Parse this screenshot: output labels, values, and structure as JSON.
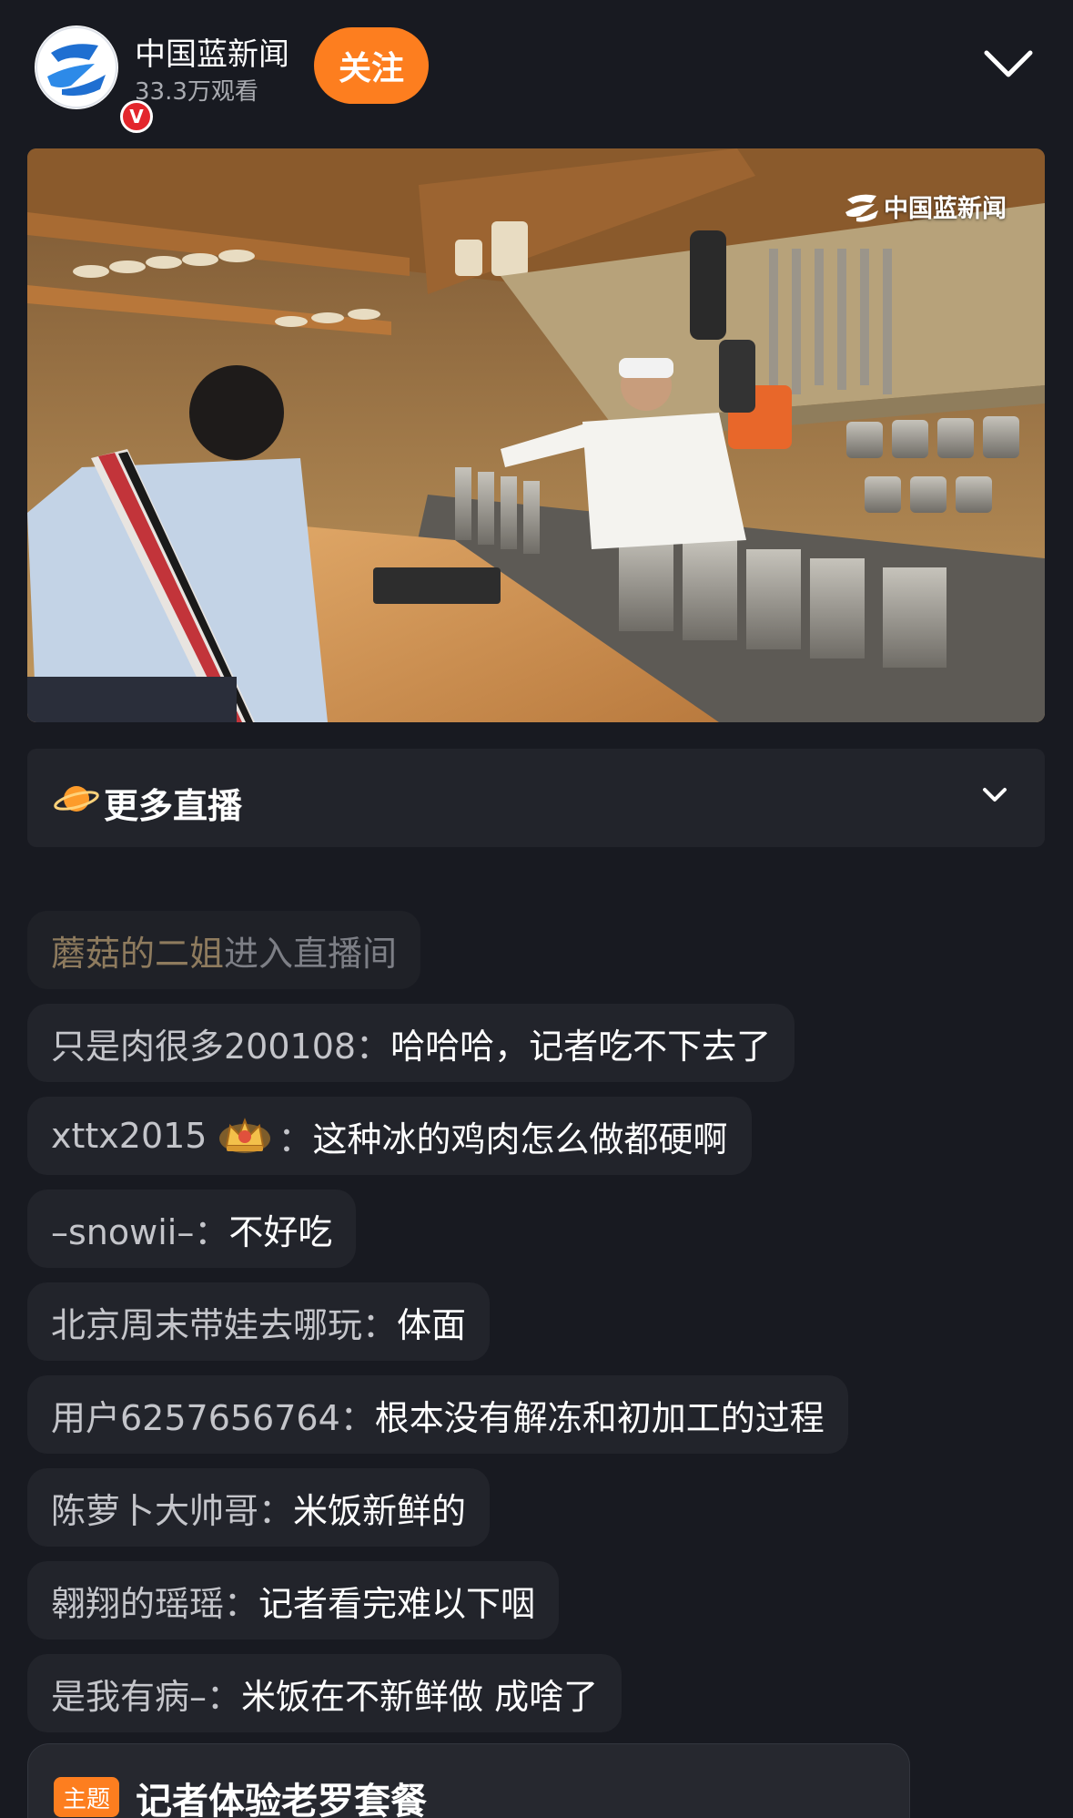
{
  "header": {
    "channel_name": "中国蓝新闻",
    "viewers": "33.3万观看",
    "follow_label": "关注",
    "verified_mark": "V",
    "avatar_icon": "zhejiang-tv-logo",
    "collapse_icon": "chevron-down-icon"
  },
  "video": {
    "watermark": "中国蓝新闻"
  },
  "more_live": {
    "label": "更多直播",
    "icon": "planet-icon",
    "chevron_icon": "chevron-down-icon"
  },
  "chat": {
    "messages": [
      {
        "user": "蘑菇的二姐",
        "text": " 进入直播间",
        "type": "enter"
      },
      {
        "user": "只是肉很多200108：",
        "text": "哈哈哈，记者吃不下去了"
      },
      {
        "user": "xttx2015",
        "badge": "crown-icon",
        "sep": "：",
        "text": "这种冰的鸡肉怎么做都硬啊"
      },
      {
        "user": "–snowii–：",
        "text": "不好吃"
      },
      {
        "user": "北京周末带娃去哪玩：",
        "text": "体面"
      },
      {
        "user": "用户6257656764：",
        "text": "根本没有解冻和初加工的过程"
      },
      {
        "user": "陈萝卜大帅哥：",
        "text": "米饭新鲜的"
      },
      {
        "user": "翱翔的瑶瑶：",
        "text": "记者看完难以下咽"
      },
      {
        "user": "是我有病–：",
        "text": "米饭在不新鲜做 成啥了"
      }
    ]
  },
  "topic": {
    "badge": "主题",
    "title": "记者体验老罗套餐"
  },
  "colors": {
    "background": "#181a21",
    "accent_orange": "#fd7e1f",
    "bubble": "#22242b"
  }
}
